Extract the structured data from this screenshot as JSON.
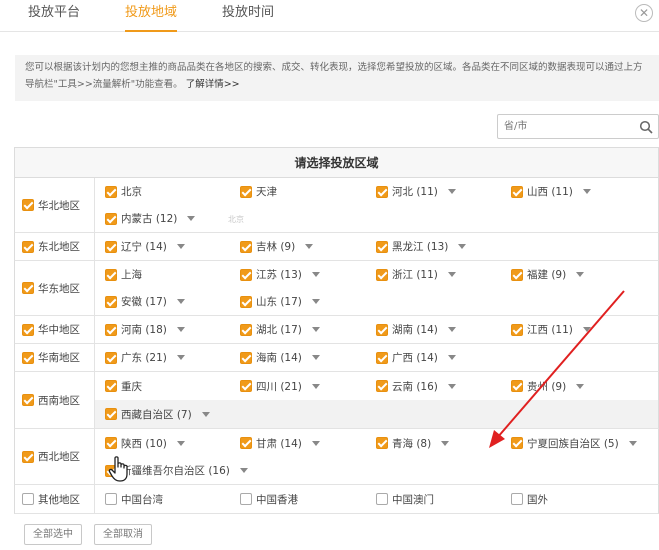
{
  "tabs": [
    {
      "label": "投放平台",
      "active": false
    },
    {
      "label": "投放地域",
      "active": true
    },
    {
      "label": "投放时间",
      "active": false
    }
  ],
  "close_icon": "close-icon",
  "notice": {
    "text": "您可以根据该计划内的您想主推的商品品类在各地区的搜索、成交、转化表现，选择您希望投放的区域。各品类在不同区域的数据表现可以通过上方导航栏\"工具>>流量解析\"功能查看。",
    "more": "了解详情>>"
  },
  "search": {
    "placeholder": "省/市",
    "icon": "search-icon"
  },
  "table": {
    "header": "请选择投放区域",
    "faint_text": "北京"
  },
  "regions": {
    "north": {
      "label": "华北地区",
      "items": [
        {
          "name": "北京"
        },
        {
          "name": "天津"
        },
        {
          "name": "河北 (11)"
        },
        {
          "name": "山西 (11)"
        },
        {
          "name": "内蒙古 (12)"
        }
      ]
    },
    "northeast": {
      "label": "东北地区",
      "items": [
        {
          "name": "辽宁 (14)"
        },
        {
          "name": "吉林 (9)"
        },
        {
          "name": "黑龙江 (13)"
        }
      ]
    },
    "east": {
      "label": "华东地区",
      "items": [
        {
          "name": "上海"
        },
        {
          "name": "江苏 (13)"
        },
        {
          "name": "浙江 (11)"
        },
        {
          "name": "福建 (9)"
        },
        {
          "name": "安徽 (17)"
        },
        {
          "name": "山东 (17)"
        }
      ]
    },
    "central": {
      "label": "华中地区",
      "items": [
        {
          "name": "河南 (18)"
        },
        {
          "name": "湖北 (17)"
        },
        {
          "name": "湖南 (14)"
        },
        {
          "name": "江西 (11)"
        }
      ]
    },
    "south": {
      "label": "华南地区",
      "items": [
        {
          "name": "广东 (21)"
        },
        {
          "name": "海南 (14)"
        },
        {
          "name": "广西 (14)"
        }
      ]
    },
    "southwest": {
      "label": "西南地区",
      "items": [
        {
          "name": "重庆"
        },
        {
          "name": "四川 (21)"
        },
        {
          "name": "云南 (16)"
        },
        {
          "name": "贵州 (9)"
        },
        {
          "name": "西藏自治区 (7)"
        }
      ]
    },
    "northwest": {
      "label": "西北地区",
      "items": [
        {
          "name": "陕西 (10)"
        },
        {
          "name": "甘肃 (14)"
        },
        {
          "name": "青海 (8)"
        },
        {
          "name": "宁夏回族自治区 (5)"
        },
        {
          "name": "新疆维吾尔自治区 (16)"
        }
      ]
    },
    "other": {
      "label": "其他地区",
      "items": [
        {
          "name": "中国台湾"
        },
        {
          "name": "中国香港"
        },
        {
          "name": "中国澳门"
        },
        {
          "name": "国外"
        }
      ]
    }
  },
  "buttons": {
    "select_all": "全部选中",
    "cancel_all": "全部取消"
  },
  "colors": {
    "accent": "#f09a1a",
    "annotation_arrow": "#e02020"
  }
}
